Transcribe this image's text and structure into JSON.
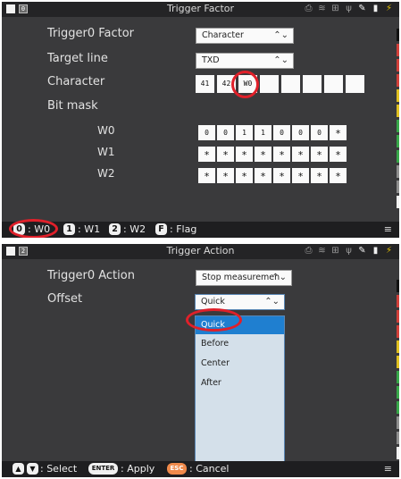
{
  "panel1": {
    "title": "Trigger Factor",
    "tab_badge": "0",
    "rows": {
      "factor_label": "Trigger0 Factor",
      "factor_value": "Character",
      "target_label": "Target line",
      "target_value": "TXD",
      "character_label": "Character",
      "bitmask_label": "Bit mask"
    },
    "character_cells": [
      "41",
      "42",
      "W0",
      "",
      "",
      "",
      "",
      ""
    ],
    "bitmask": [
      {
        "label": "W0",
        "cells": [
          "0",
          "0",
          "1",
          "1",
          "0",
          "0",
          "0",
          "*"
        ]
      },
      {
        "label": "W1",
        "cells": [
          "*",
          "*",
          "*",
          "*",
          "*",
          "*",
          "*",
          "*"
        ]
      },
      {
        "label": "W2",
        "cells": [
          "*",
          "*",
          "*",
          "*",
          "*",
          "*",
          "*",
          "*"
        ]
      }
    ],
    "bottom": {
      "k0": "0",
      "t0": ": W0",
      "k1": "1",
      "t1": ": W1",
      "k2": "2",
      "t2": ": W2",
      "kf": "F",
      "tf": ": Flag"
    }
  },
  "panel2": {
    "title": "Trigger Action",
    "tab_badge": "2",
    "rows": {
      "action_label": "Trigger0  Action",
      "action_value": "Stop measuremen",
      "offset_label": "Offset",
      "offset_value": "Quick"
    },
    "dropdown_options": [
      "Quick",
      "Before",
      "Center",
      "After"
    ],
    "selected_option": "Quick",
    "bottom": {
      "up": "▲",
      "down": "▼",
      "t_select": ": Select",
      "enter": "ENTER",
      "t_apply": ": Apply",
      "esc": "ESC",
      "t_cancel": ": Cancel"
    }
  },
  "status_icons": [
    "printer-icon",
    "wifi-icon",
    "network-icon",
    "usb-icon",
    "pen-icon",
    "sd-card-icon",
    "battery-icon"
  ],
  "sidebar_colors": [
    "#111111",
    "#d2403a",
    "#d2403a",
    "#d2403a",
    "#e0c020",
    "#e0c020",
    "#38a84a",
    "#38a84a",
    "#38a84a",
    "#909090",
    "#909090",
    "#f2f2f2"
  ],
  "colors": {
    "accent_ring": "#e0202a",
    "selection": "#1f7fd0",
    "esc_key": "#f08a4b"
  }
}
